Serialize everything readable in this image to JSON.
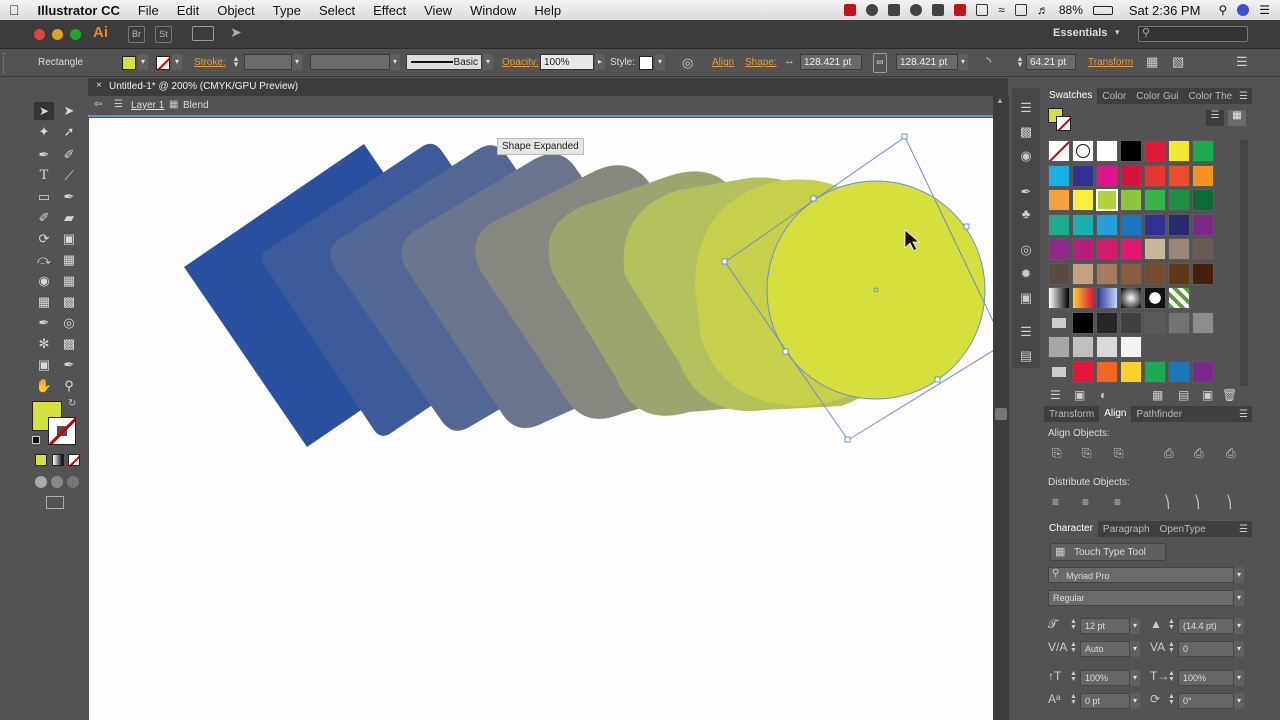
{
  "menubar": {
    "apple": "",
    "app": "Illustrator CC",
    "items": [
      "File",
      "Edit",
      "Object",
      "Type",
      "Select",
      "Effect",
      "View",
      "Window",
      "Help"
    ],
    "battery": "88%",
    "clock": "Sat 2:36 PM"
  },
  "appbar": {
    "logo": "Ai",
    "br": "Br",
    "st": "St",
    "workspace": "Essentials",
    "search_placeholder": ""
  },
  "control": {
    "object_type": "Rectangle",
    "stroke_label": "Stroke:",
    "stroke_style": "Basic",
    "opacity_label": "Opacity:",
    "opacity": "100%",
    "style_label": "Style:",
    "align_label": "Align",
    "shape_label": "Shape:",
    "width": "128.421 pt",
    "height": "128.421 pt",
    "radius": "64.21 pt",
    "transform_label": "Transform",
    "fill_color": "#d5e03c"
  },
  "document": {
    "tab": "Untitled-1* @ 200% (CMYK/GPU Preview)",
    "layer": "Layer 1",
    "blend": "Blend",
    "tooltip": "Shape Expanded"
  },
  "blend": {
    "colors": [
      "#2a50a0",
      "#3d5a9a",
      "#526794",
      "#6b768e",
      "#86887f",
      "#9ba66f",
      "#b4c05b",
      "#c6d04b",
      "#d5e03c"
    ],
    "rotation_deg": -30
  },
  "swatches": {
    "tabs": [
      "Swatches",
      "Color",
      "Color Gui",
      "Color The"
    ],
    "grid": [
      [
        "none",
        "reg",
        "#ffffff",
        "#000000",
        "#e2173a",
        "#f3e82b",
        "#1aaa50"
      ],
      [
        "#17b0e6",
        "#2e3192",
        "#e2138d",
        "#d4143a",
        "#e8342e",
        "#ee4b2f",
        "#f6931d"
      ],
      [
        "#f4a13a",
        "#f8ee3e",
        "#b3d33d",
        "#8cc63f",
        "#37b44a",
        "#1d8e44",
        "#0c6c39"
      ],
      [
        "#1dac8a",
        "#1bafb1",
        "#23a0d8",
        "#1b75bb",
        "#2f3192",
        "#272a6f",
        "#7b2a8a"
      ],
      [
        "#8f2a8a",
        "#b51f7a",
        "#d41a6b",
        "#e3176f",
        "#c8b79a",
        "#9a8678",
        "#6a5b52"
      ],
      [
        "#584b43",
        "#c4a17f",
        "#a57c5b",
        "#8a5c3e",
        "#754c2c",
        "#603813",
        "#42210b"
      ],
      [
        "grad1",
        "grad2",
        "grad3",
        "grad4",
        "grad5",
        "grad6",
        ""
      ],
      [
        "folder",
        "#000000",
        "#262626",
        "#404040",
        "#595959",
        "#737373",
        "#8c8c8c"
      ],
      [
        "#a6a6a6",
        "#bfbfbf",
        "#d9d9d9",
        "#f2f2f2",
        "",
        "",
        ""
      ],
      [
        "folder",
        "#e2173a",
        "#f36523",
        "#f9d22b",
        "#1aaa50",
        "#1b75bb",
        "#7b2a8a"
      ]
    ]
  },
  "align": {
    "tabs": [
      "Transform",
      "Align",
      "Pathfinder"
    ],
    "align_objects": "Align Objects:",
    "distribute_objects": "Distribute Objects:"
  },
  "character": {
    "tabs": [
      "Character",
      "Paragraph",
      "OpenType"
    ],
    "touch_type": "Touch Type Tool",
    "font": "Myriad Pro",
    "style": "Regular",
    "size": "12 pt",
    "leading": "(14.4 pt)",
    "kerning": "Auto",
    "tracking": "0",
    "vscale": "100%",
    "hscale": "100%",
    "baseline": "0 pt",
    "rotation": "0°"
  }
}
